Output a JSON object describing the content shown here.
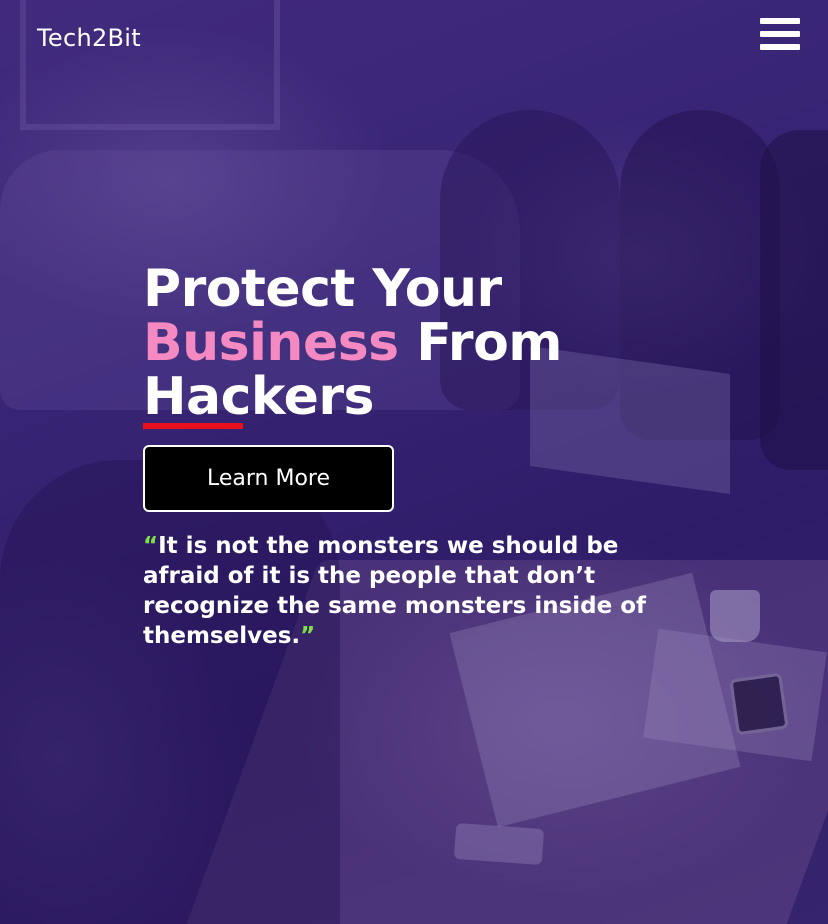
{
  "header": {
    "brand": "Tech2Bit",
    "menu_icon": "hamburger-menu-icon"
  },
  "hero": {
    "headline_line1": "Protect Your",
    "headline_line2_accent": "Business",
    "headline_line2_rest": " From",
    "headline_line3": "Hackers",
    "cta_label": "Learn More",
    "quote_open": "“",
    "quote_text": "It is not the monsters we should be afraid of it is the people that don’t recognize the same monsters inside of themselves.",
    "quote_close": "”"
  },
  "colors": {
    "accent_pink": "#f58ac3",
    "underline_red": "#e8101d",
    "quote_mark_green": "#7ee04a",
    "overlay_purple": "#3b2a78",
    "button_bg": "#000000"
  }
}
